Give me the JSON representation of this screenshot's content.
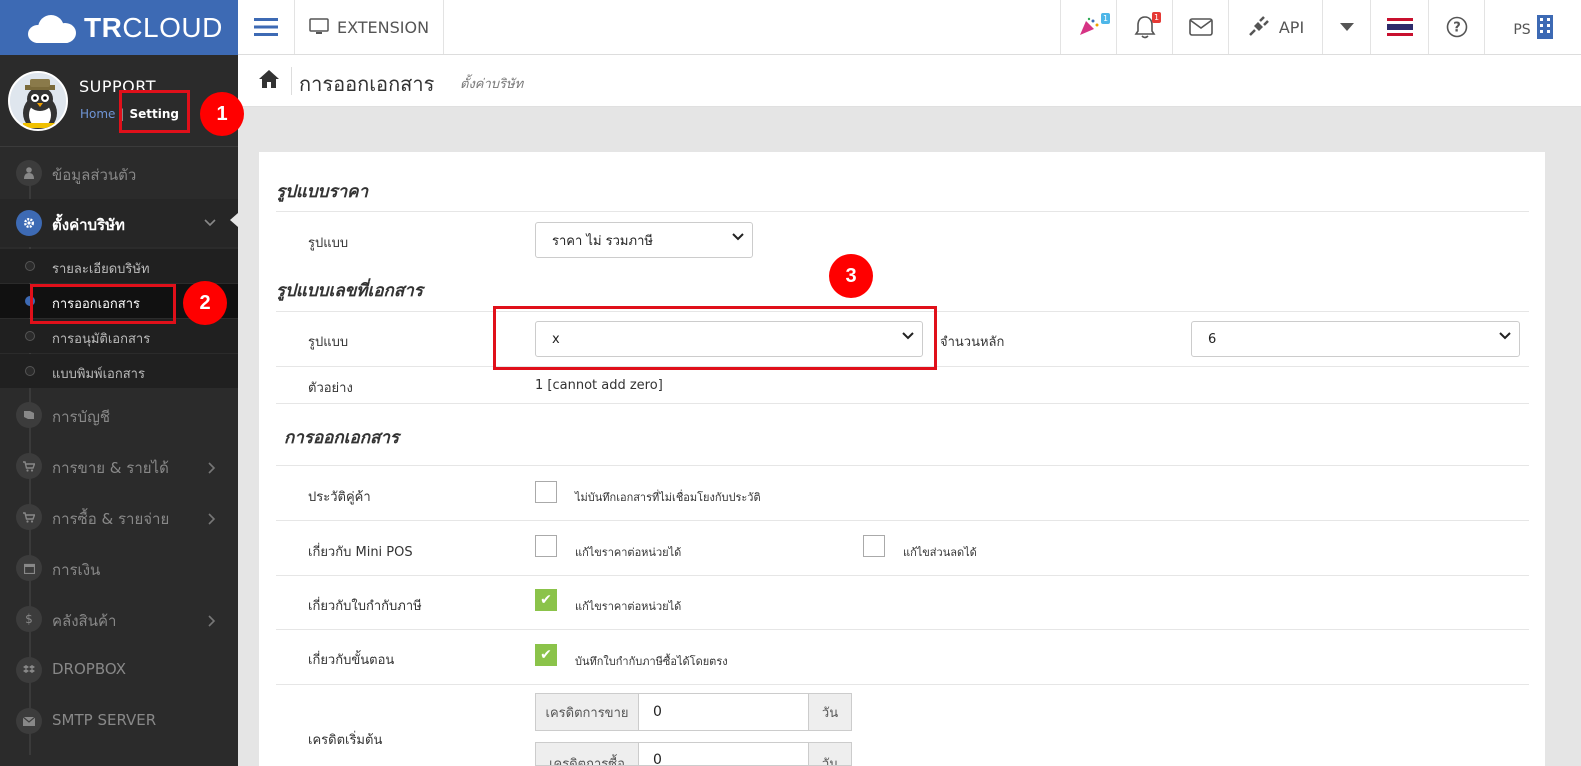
{
  "brand": {
    "name_bold": "TR",
    "name_light": "CLOUD"
  },
  "topbar": {
    "extension_label": "EXTENSION",
    "api_label": "API",
    "user_initials": "PS",
    "news_badge": "1",
    "notif_badge": "1"
  },
  "profile": {
    "name": "SUPPORT",
    "home_link": "Home",
    "separator": "|",
    "setting_link": "Setting"
  },
  "sidebar": {
    "items": [
      {
        "label": "ข้อมูลส่วนตัว"
      },
      {
        "label": "ตั้งค่าบริษัท"
      },
      {
        "label": "การบัญชี"
      },
      {
        "label": "การขาย & รายได้"
      },
      {
        "label": "การซื้อ & รายจ่าย"
      },
      {
        "label": "การเงิน"
      },
      {
        "label": "คลังสินค้า"
      },
      {
        "label": "DROPBOX"
      },
      {
        "label": "SMTP SERVER"
      }
    ],
    "sub_items": [
      {
        "label": "รายละเอียดบริษัท"
      },
      {
        "label": "การออกเอกสาร"
      },
      {
        "label": "การอนุมัติเอกสาร"
      },
      {
        "label": "แบบพิมพ์เอกสาร"
      }
    ]
  },
  "page": {
    "title": "การออกเอกสาร",
    "subtitle": "ตั้งค่าบริษัท"
  },
  "price_format": {
    "section_title": "รูปแบบราคา",
    "label": "รูปแบบ",
    "value": "ราคา ไม่ รวมภาษี"
  },
  "doc_number": {
    "section_title": "รูปแบบเลขที่เอกสาร",
    "format_label": "รูปแบบ",
    "format_value": "x",
    "digits_label": "จำนวนหลัก",
    "digits_value": "6",
    "example_label": "ตัวอย่าง",
    "example_value": "1 [cannot add zero]"
  },
  "doc_issue": {
    "section_title": "การออกเอกสาร",
    "rows": [
      {
        "label": "ประวัติคู่ค้า",
        "options": [
          {
            "text": "ไม่บันทึกเอกสารที่ไม่เชื่อมโยงกับประวัติ",
            "checked": false
          }
        ]
      },
      {
        "label": "เกี่ยวกับ Mini POS",
        "options": [
          {
            "text": "แก้ไขราคาต่อหน่วยได้",
            "checked": false
          },
          {
            "text": "แก้ไขส่วนลดได้",
            "checked": false
          }
        ]
      },
      {
        "label": "เกี่ยวกับใบกำกับภาษี",
        "options": [
          {
            "text": "แก้ไขราคาต่อหน่วยได้",
            "checked": true
          }
        ]
      },
      {
        "label": "เกี่ยวกับขั้นตอน",
        "options": [
          {
            "text": "บันทึกใบกำกับภาษีซื้อได้โดยตรง",
            "checked": true
          }
        ]
      }
    ],
    "credit": {
      "label": "เครดิตเริ่มต้น",
      "sales_label": "เครดิตการขาย",
      "sales_value": "0",
      "purchase_label": "เครดิตการซื้อ",
      "purchase_value": "0",
      "unit": "วัน"
    }
  },
  "annotations": {
    "step1": "1",
    "step2": "2",
    "step3": "3"
  },
  "colors": {
    "brand_blue": "#3d6ab4",
    "sidebar_bg": "#2b2b2b",
    "annotation_red": "#ff0000",
    "check_green": "#8bc34a"
  }
}
